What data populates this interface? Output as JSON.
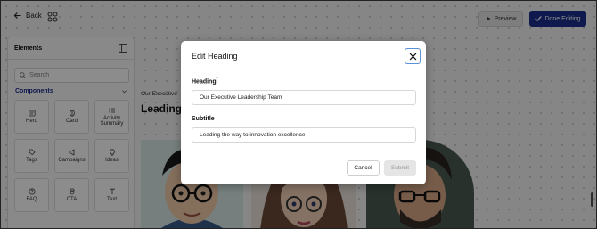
{
  "topbar": {
    "back_label": "Back",
    "preview_label": "Preview",
    "done_label": "Done Editing"
  },
  "sidebar": {
    "title": "Elements",
    "search_placeholder": "Search",
    "components_label": "Components",
    "tiles": [
      {
        "label": "Hero",
        "icon": "hero-icon"
      },
      {
        "label": "Card",
        "icon": "card-icon"
      },
      {
        "label": "Activity Summary",
        "icon": "activity-summary-icon"
      },
      {
        "label": "Tags",
        "icon": "tags-icon"
      },
      {
        "label": "Campaigns",
        "icon": "campaigns-icon"
      },
      {
        "label": "Ideas",
        "icon": "ideas-icon"
      },
      {
        "label": "FAQ",
        "icon": "faq-icon"
      },
      {
        "label": "CTA",
        "icon": "cta-icon"
      },
      {
        "label": "Text",
        "icon": "text-icon"
      }
    ]
  },
  "canvas": {
    "subtitle_partial": "Our Executive",
    "heading_partial": "Leading"
  },
  "modal": {
    "title": "Edit Heading",
    "heading_label": "Heading",
    "required_mark": "*",
    "heading_value": "Our Executive Leadership Team",
    "subtitle_label": "Subtitle",
    "subtitle_value": "Leading the way to innovation excellence",
    "cancel_label": "Cancel",
    "submit_label": "Submit"
  },
  "colors": {
    "accent": "#1d2f8f",
    "close_focus": "#5b8fd6"
  }
}
